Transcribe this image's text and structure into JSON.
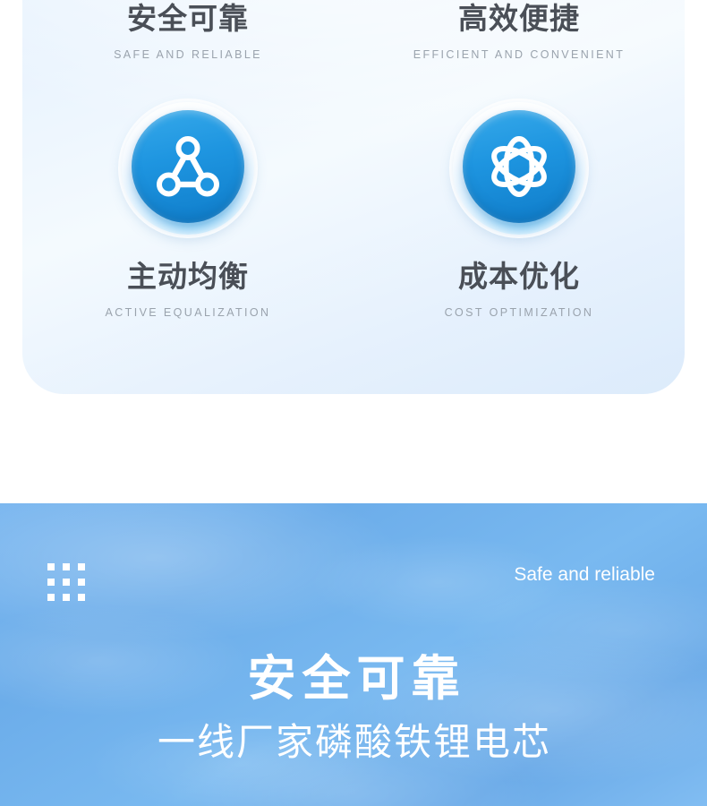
{
  "feature_card": {
    "columns": [
      {
        "heading_cn": "安全可靠",
        "heading_en": "SAFE AND RELIABLE",
        "icon_name": "node-triangle-icon",
        "label_cn": "主动均衡",
        "label_en": "ACTIVE EQUALIZATION"
      },
      {
        "heading_cn": "高效便捷",
        "heading_en": "EFFICIENT AND CONVENIENT",
        "icon_name": "atom-orbit-icon",
        "label_cn": "成本优化",
        "label_en": "COST OPTIMIZATION"
      }
    ]
  },
  "banner": {
    "dots_icon_name": "grid-dots-icon",
    "tagline": "Safe and reliable",
    "headline": "安全可靠",
    "subline": "一线厂家磷酸铁锂电芯"
  },
  "colors": {
    "brand_blue": "#1e95e0",
    "banner_blue": "#79b6ef",
    "heading_gray": "#4a4f57",
    "subtext_gray": "#9aa3ad",
    "card_bg": "#e6f1fd",
    "white": "#ffffff"
  }
}
